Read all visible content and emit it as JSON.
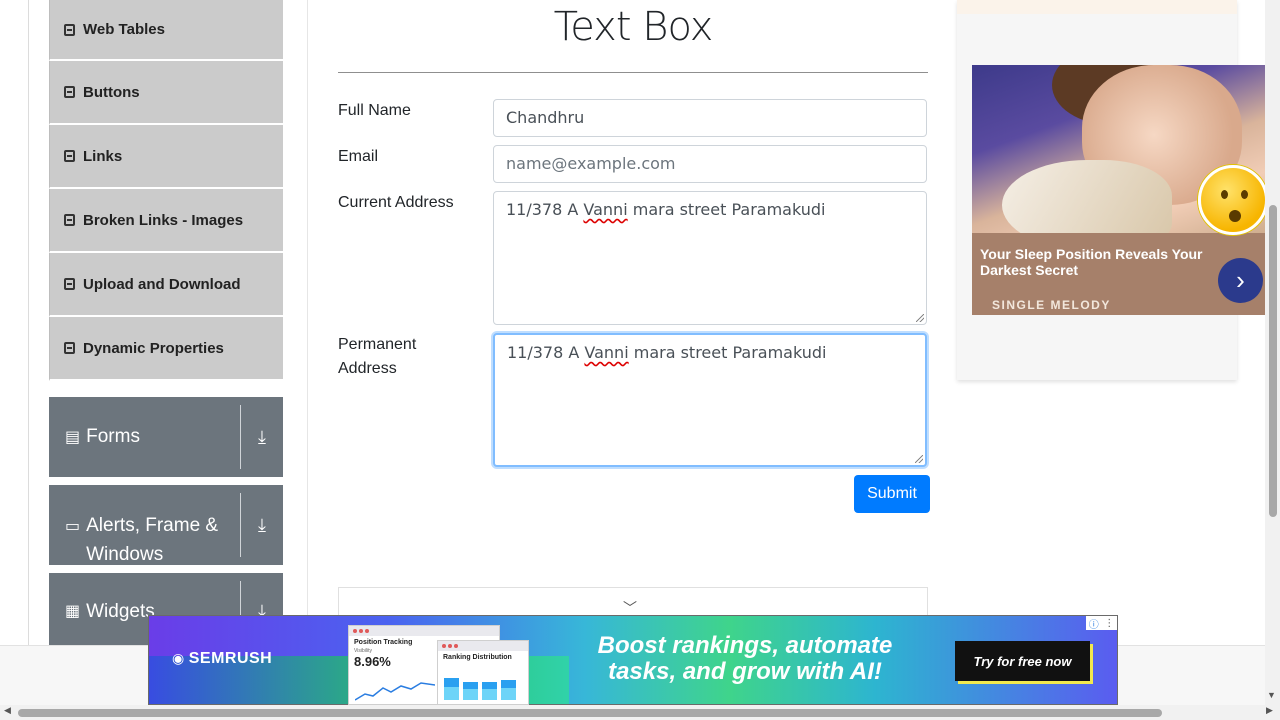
{
  "sidebar": {
    "items": [
      {
        "label": "Web Tables"
      },
      {
        "label": "Buttons"
      },
      {
        "label": "Links"
      },
      {
        "label": "Broken Links - Images"
      },
      {
        "label": "Upload and Download"
      },
      {
        "label": "Dynamic Properties"
      }
    ],
    "groups": [
      {
        "label": "Forms"
      },
      {
        "label": "Alerts, Frame & Windows"
      },
      {
        "label": "Widgets"
      }
    ]
  },
  "main": {
    "title": "Text Box",
    "full_name_label": "Full Name",
    "full_name_value": "Chandhru",
    "email_label": "Email",
    "email_placeholder": "name@example.com",
    "current_address_label": "Current Address",
    "current_address": {
      "a": "11/378 A ",
      "b": "Vanni",
      "c": " mara street Paramakudi"
    },
    "permanent_address_label_1": "Permanent",
    "permanent_address_label_2": "Address",
    "permanent_address": {
      "a": "11/378 A ",
      "b": "Vanni",
      "c": " mara street Paramakudi"
    },
    "submit_label": "Submit"
  },
  "side_ad": {
    "headline": "Your Sleep Position Reveals Your Darkest Secret",
    "brand": "SINGLE MELODY"
  },
  "banner_ad": {
    "brand": "SEMRUSH",
    "card1_title": "Position Tracking",
    "card1_sub": "Visibility",
    "card1_value": "8.96%",
    "card2_title": "Ranking Distribution",
    "headline": "Boost rankings, automate tasks, and grow with AI!",
    "cta": "Try for free now"
  },
  "colors": {
    "primary": "#007bff",
    "sidebar_item_bg": "#cbcbcb",
    "group_bg": "#6c757d",
    "focus_ring": "#80bdff"
  }
}
